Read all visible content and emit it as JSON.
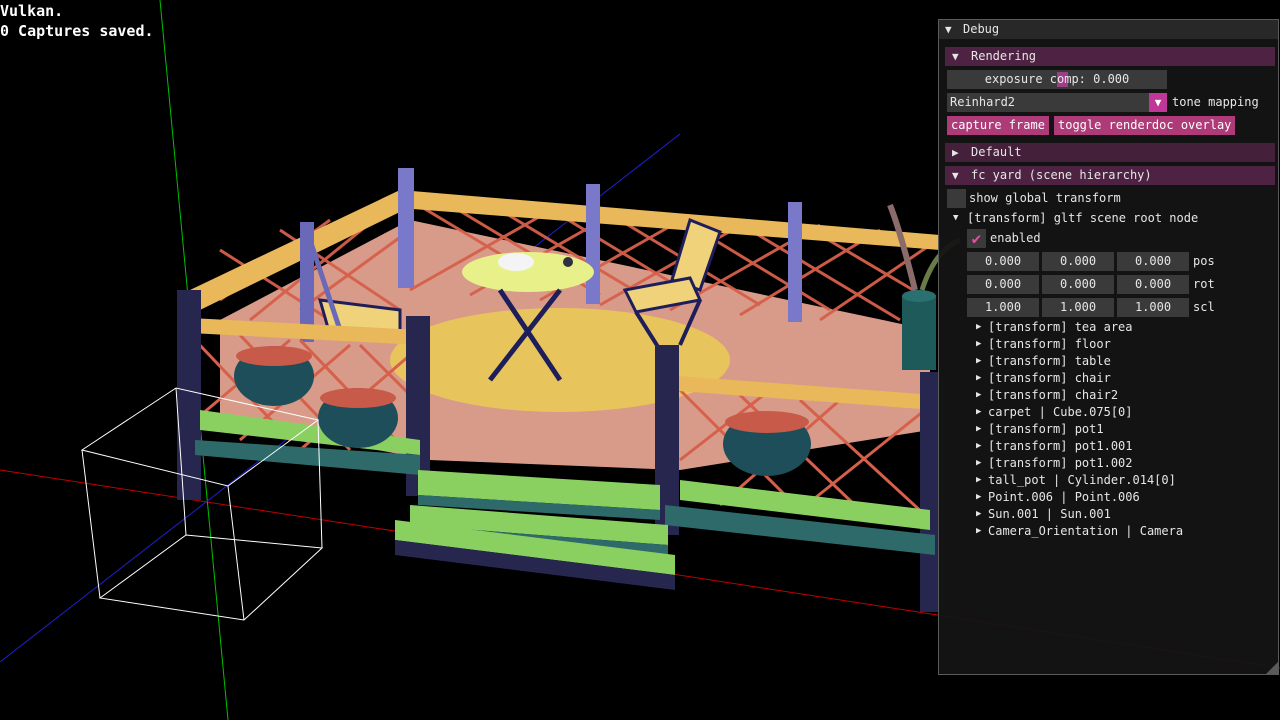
{
  "overlay": {
    "line1": "Vulkan.",
    "line2": "0 Captures saved."
  },
  "debug": {
    "title": "Debug",
    "rendering": {
      "header": "Rendering",
      "exposure_label": "exposure comp: 0.000",
      "tone_mapping_value": "Reinhard2",
      "tone_mapping_label": "tone mapping",
      "capture_frame": "capture frame",
      "toggle_overlay": "toggle renderdoc overlay"
    },
    "default_header": "Default",
    "scene": {
      "header": "fc yard (scene hierarchy)",
      "show_global_transform": "show global transform",
      "root_node": "[transform] gltf scene root node",
      "enabled": "enabled",
      "pos": [
        "0.000",
        "0.000",
        "0.000"
      ],
      "rot": [
        "0.000",
        "0.000",
        "0.000"
      ],
      "scl": [
        "1.000",
        "1.000",
        "1.000"
      ],
      "pos_label": "pos",
      "rot_label": "rot",
      "scl_label": "scl",
      "children": [
        "[transform] tea area",
        "[transform] floor",
        "[transform] table",
        "[transform] chair",
        "[transform] chair2",
        "carpet | Cube.075[0]",
        "[transform] pot1",
        "[transform] pot1.001",
        "[transform] pot1.002",
        "tall_pot | Cylinder.014[0]",
        "Point.006 | Point.006",
        "Sun.001 | Sun.001",
        "Camera_Orientation | Camera"
      ]
    }
  },
  "colors": {
    "accent": "#ae3a78",
    "header": "#44203a",
    "frame": "#3a3a3a",
    "check": "#e04fa0"
  }
}
